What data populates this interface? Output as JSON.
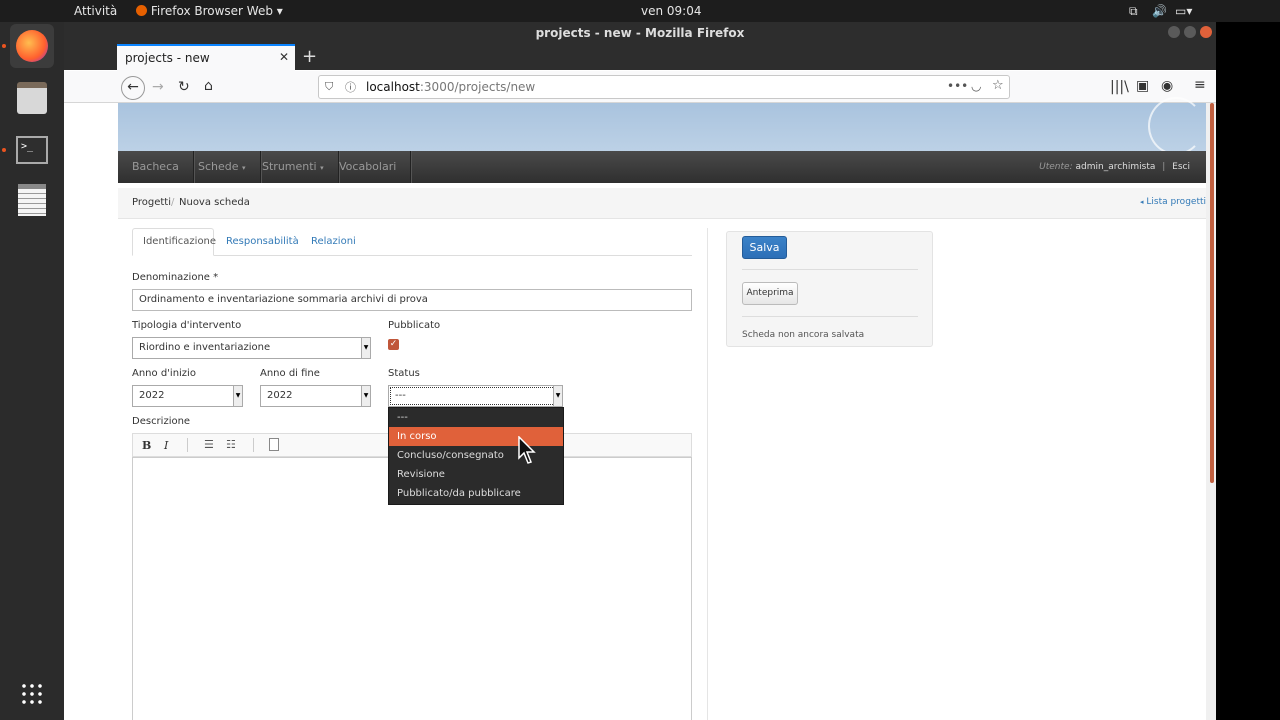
{
  "system": {
    "activities": "Attività",
    "app_menu": "Firefox Browser Web",
    "clock": "ven 09:04"
  },
  "browser": {
    "window_title": "projects - new - Mozilla Firefox",
    "tab_title": "projects - new",
    "url_host": "localhost",
    "url_path": ":3000/projects/new"
  },
  "menu": {
    "items": [
      "Bacheca",
      "Schede",
      "Strumenti",
      "Vocabolari"
    ],
    "user_label": "Utente:",
    "user_name": "admin_archimista",
    "separator": "|",
    "logout": "Esci"
  },
  "breadcrumb": {
    "root": "Progetti",
    "sep": "/",
    "current": "Nuova scheda",
    "list_link": "Lista progetti"
  },
  "tabs": [
    "Identificazione",
    "Responsabilità",
    "Relazioni"
  ],
  "form": {
    "denominazione_label": "Denominazione *",
    "denominazione_value": "Ordinamento e inventariazione sommaria archivi di prova",
    "tipologia_label": "Tipologia d'intervento",
    "tipologia_value": "Riordino e inventariazione",
    "pubblicato_label": "Pubblicato",
    "pubblicato_checked": true,
    "anno_inizio_label": "Anno d'inizio",
    "anno_inizio_value": "2022",
    "anno_fine_label": "Anno di fine",
    "anno_fine_value": "2022",
    "status_label": "Status",
    "status_value": "---",
    "status_options": [
      "---",
      "In corso",
      "Concluso/consegnato",
      "Revisione",
      "Pubblicato/da pubblicare"
    ],
    "status_highlighted": "In corso",
    "descrizione_label": "Descrizione",
    "editor_buttons": [
      "B",
      "I"
    ]
  },
  "sidebar": {
    "save": "Salva",
    "preview": "Anteprima",
    "note": "Scheda non ancora salvata"
  },
  "colors": {
    "accent": "#e0613a",
    "primary_button": "#2c6fb7",
    "link": "#337ab7"
  }
}
